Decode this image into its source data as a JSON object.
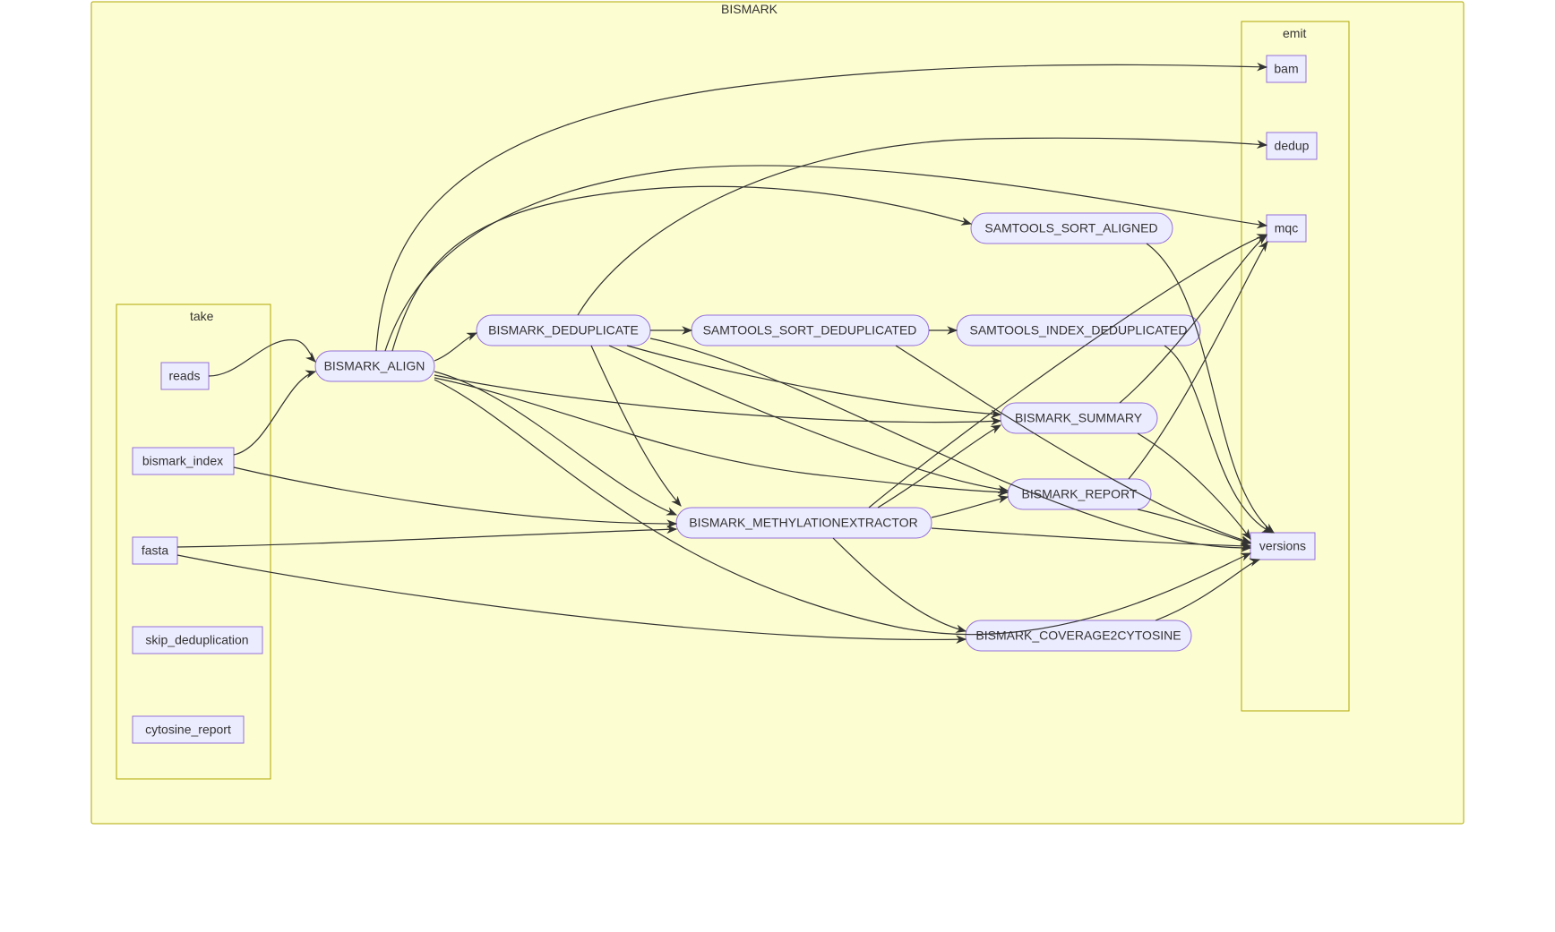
{
  "diagram": {
    "title": "BISMARK",
    "clusters": {
      "take": {
        "label": "take"
      },
      "emit": {
        "label": "emit"
      }
    },
    "nodes": {
      "reads": {
        "label": "reads"
      },
      "bismark_index": {
        "label": "bismark_index"
      },
      "fasta": {
        "label": "fasta"
      },
      "skip_deduplication": {
        "label": "skip_deduplication"
      },
      "cytosine_report": {
        "label": "cytosine_report"
      },
      "bismark_align": {
        "label": "BISMARK_ALIGN"
      },
      "bismark_deduplicate": {
        "label": "BISMARK_DEDUPLICATE"
      },
      "samtools_sort_deduplicated": {
        "label": "SAMTOOLS_SORT_DEDUPLICATED"
      },
      "bismark_methylationextractor": {
        "label": "BISMARK_METHYLATIONEXTRACTOR"
      },
      "samtools_sort_aligned": {
        "label": "SAMTOOLS_SORT_ALIGNED"
      },
      "samtools_index_deduplicated": {
        "label": "SAMTOOLS_INDEX_DEDUPLICATED"
      },
      "bismark_summary": {
        "label": "BISMARK_SUMMARY"
      },
      "bismark_report": {
        "label": "BISMARK_REPORT"
      },
      "bismark_coverage2cytosine": {
        "label": "BISMARK_COVERAGE2CYTOSINE"
      },
      "bam": {
        "label": "bam"
      },
      "dedup": {
        "label": "dedup"
      },
      "mqc": {
        "label": "mqc"
      },
      "versions": {
        "label": "versions"
      }
    },
    "edges": [
      [
        "reads",
        "bismark_align"
      ],
      [
        "bismark_index",
        "bismark_align"
      ],
      [
        "bismark_index",
        "bismark_methylationextractor"
      ],
      [
        "fasta",
        "bismark_methylationextractor"
      ],
      [
        "fasta",
        "bismark_coverage2cytosine"
      ],
      [
        "bismark_align",
        "bismark_deduplicate"
      ],
      [
        "bismark_align",
        "samtools_sort_aligned"
      ],
      [
        "bismark_align",
        "bismark_methylationextractor"
      ],
      [
        "bismark_align",
        "bismark_summary"
      ],
      [
        "bismark_align",
        "bismark_report"
      ],
      [
        "bismark_align",
        "bam"
      ],
      [
        "bismark_align",
        "mqc"
      ],
      [
        "bismark_align",
        "versions"
      ],
      [
        "bismark_deduplicate",
        "samtools_sort_deduplicated"
      ],
      [
        "bismark_deduplicate",
        "bismark_methylationextractor"
      ],
      [
        "bismark_deduplicate",
        "bismark_summary"
      ],
      [
        "bismark_deduplicate",
        "bismark_report"
      ],
      [
        "bismark_deduplicate",
        "dedup"
      ],
      [
        "bismark_deduplicate",
        "versions"
      ],
      [
        "samtools_sort_deduplicated",
        "samtools_index_deduplicated"
      ],
      [
        "samtools_sort_deduplicated",
        "versions"
      ],
      [
        "bismark_methylationextractor",
        "bismark_summary"
      ],
      [
        "bismark_methylationextractor",
        "bismark_report"
      ],
      [
        "bismark_methylationextractor",
        "bismark_coverage2cytosine"
      ],
      [
        "bismark_methylationextractor",
        "mqc"
      ],
      [
        "bismark_methylationextractor",
        "versions"
      ],
      [
        "samtools_sort_aligned",
        "versions"
      ],
      [
        "samtools_index_deduplicated",
        "versions"
      ],
      [
        "bismark_summary",
        "mqc"
      ],
      [
        "bismark_summary",
        "versions"
      ],
      [
        "bismark_report",
        "mqc"
      ],
      [
        "bismark_report",
        "versions"
      ],
      [
        "bismark_coverage2cytosine",
        "versions"
      ]
    ]
  }
}
